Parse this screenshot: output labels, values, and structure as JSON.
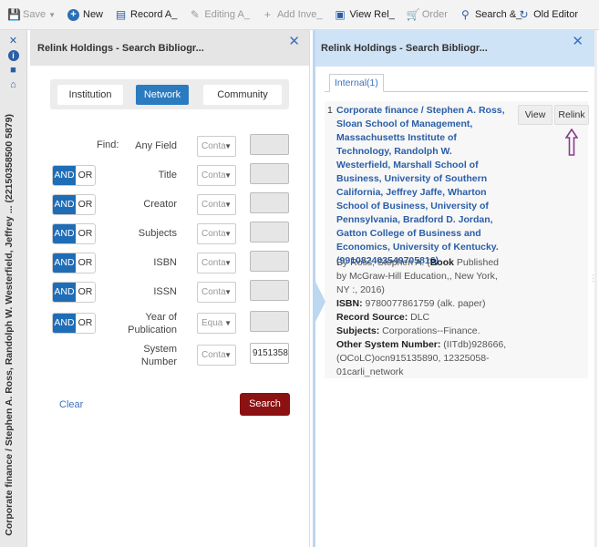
{
  "toolbar": {
    "save": "Save",
    "new": "New",
    "record_a": "Record A_",
    "editing_a": "Editing A_",
    "add_inve": "Add Inve_",
    "view_rel": "View Rel_",
    "order": "Order",
    "search": "Search &_",
    "old_editor": "Old Editor"
  },
  "side_strip": {
    "record_title": "Corporate finance / Stephen A. Ross, Randolph W. Westerfield, Jeffrey ... (22150358500 5879)"
  },
  "search_panel": {
    "title": "Relink Holdings - Search Bibliogr...",
    "scopes": [
      "Institution",
      "Network",
      "Community"
    ],
    "active_scope": "Network",
    "find_label": "Find:",
    "rows": [
      {
        "field": "Any Field",
        "bool": "",
        "op": "Conta",
        "value": ""
      },
      {
        "field": "Title",
        "bool": "AND",
        "op": "Conta",
        "value": ""
      },
      {
        "field": "Creator",
        "bool": "AND",
        "op": "Conta",
        "value": ""
      },
      {
        "field": "Subjects",
        "bool": "AND",
        "op": "Conta",
        "value": ""
      },
      {
        "field": "ISBN",
        "bool": "AND",
        "op": "Conta",
        "value": ""
      },
      {
        "field": "ISSN",
        "bool": "AND",
        "op": "Conta",
        "value": ""
      },
      {
        "field": "Year of Publication",
        "bool": "AND",
        "op": "Equa",
        "value": ""
      },
      {
        "field": "System Number",
        "bool": "",
        "op": "Conta",
        "value": "9151358"
      }
    ],
    "and_label": "AND",
    "or_label": "OR",
    "clear_label": "Clear",
    "search_label": "Search"
  },
  "results_panel": {
    "title": "Relink Holdings - Search Bibliogr...",
    "tab_label": "Internal(1)",
    "record": {
      "index": "1",
      "title": "Corporate finance / Stephen A. Ross, Sloan School of Management, Massachusetts Institute of Technology, Randolph W. Westerfield, Marshall School of Business, University of Southern California, Jeffrey Jaffe, Wharton School of Business, University of Pennsylvania, Bradford D. Jordan, Gatton College of Business and Economics, University of Kentucky. (991082403549705816)",
      "by_line": "By Ross, Stephen A. (",
      "type": "Book",
      "publisher": " Published by McGraw-Hill Education,, New York, NY :, 2016)",
      "isbn_label": "ISBN:",
      "isbn_value": " 9780077861759 (alk. paper)",
      "source_label": "Record Source:",
      "source_value": " DLC",
      "subjects_label": "Subjects:",
      "subjects_value": " Corporations--Finance.",
      "other_label": "Other System Number:",
      "other_value": " (IITdb)928666, (OCoLC)ocn915135890, 12325058-01carli_network"
    },
    "view_label": "View",
    "relink_label": "Relink"
  },
  "colors": {
    "primary_blue": "#1f6db6",
    "link_blue": "#2a5ea8",
    "search_red": "#8b1113",
    "annotation_arrow": "#8a3c8e"
  }
}
